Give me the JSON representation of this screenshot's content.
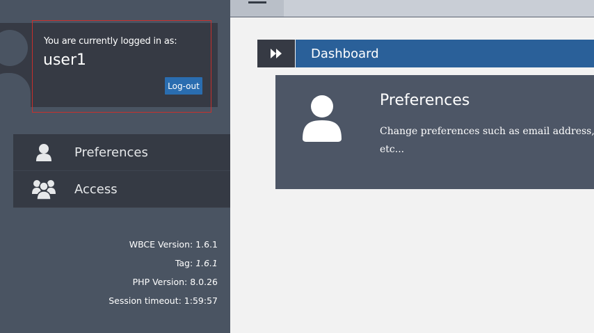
{
  "login": {
    "caption": "You are currently logged in as:",
    "username": "user1",
    "logout_label": "Log-out"
  },
  "nav": {
    "items": [
      {
        "label": "Preferences",
        "icon": "user-icon"
      },
      {
        "label": "Access",
        "icon": "group-icon"
      }
    ]
  },
  "versions": {
    "wbce": "WBCE Version: 1.6.1",
    "tag_prefix": "Tag: ",
    "tag_value": "1.6.1",
    "php": "PHP Version: 8.0.26",
    "session": "Session timeout: 1:59:57"
  },
  "breadcrumb": {
    "icon": "fast-forward-icon",
    "title": "Dashboard"
  },
  "card": {
    "title": "Preferences",
    "description": "Change preferences such as email address, etc..."
  },
  "colors": {
    "sidebar": "#4a5462",
    "panel": "#363a44",
    "accent": "#2a6099",
    "button": "#2a6db0",
    "highlight_border": "#c9302c"
  }
}
